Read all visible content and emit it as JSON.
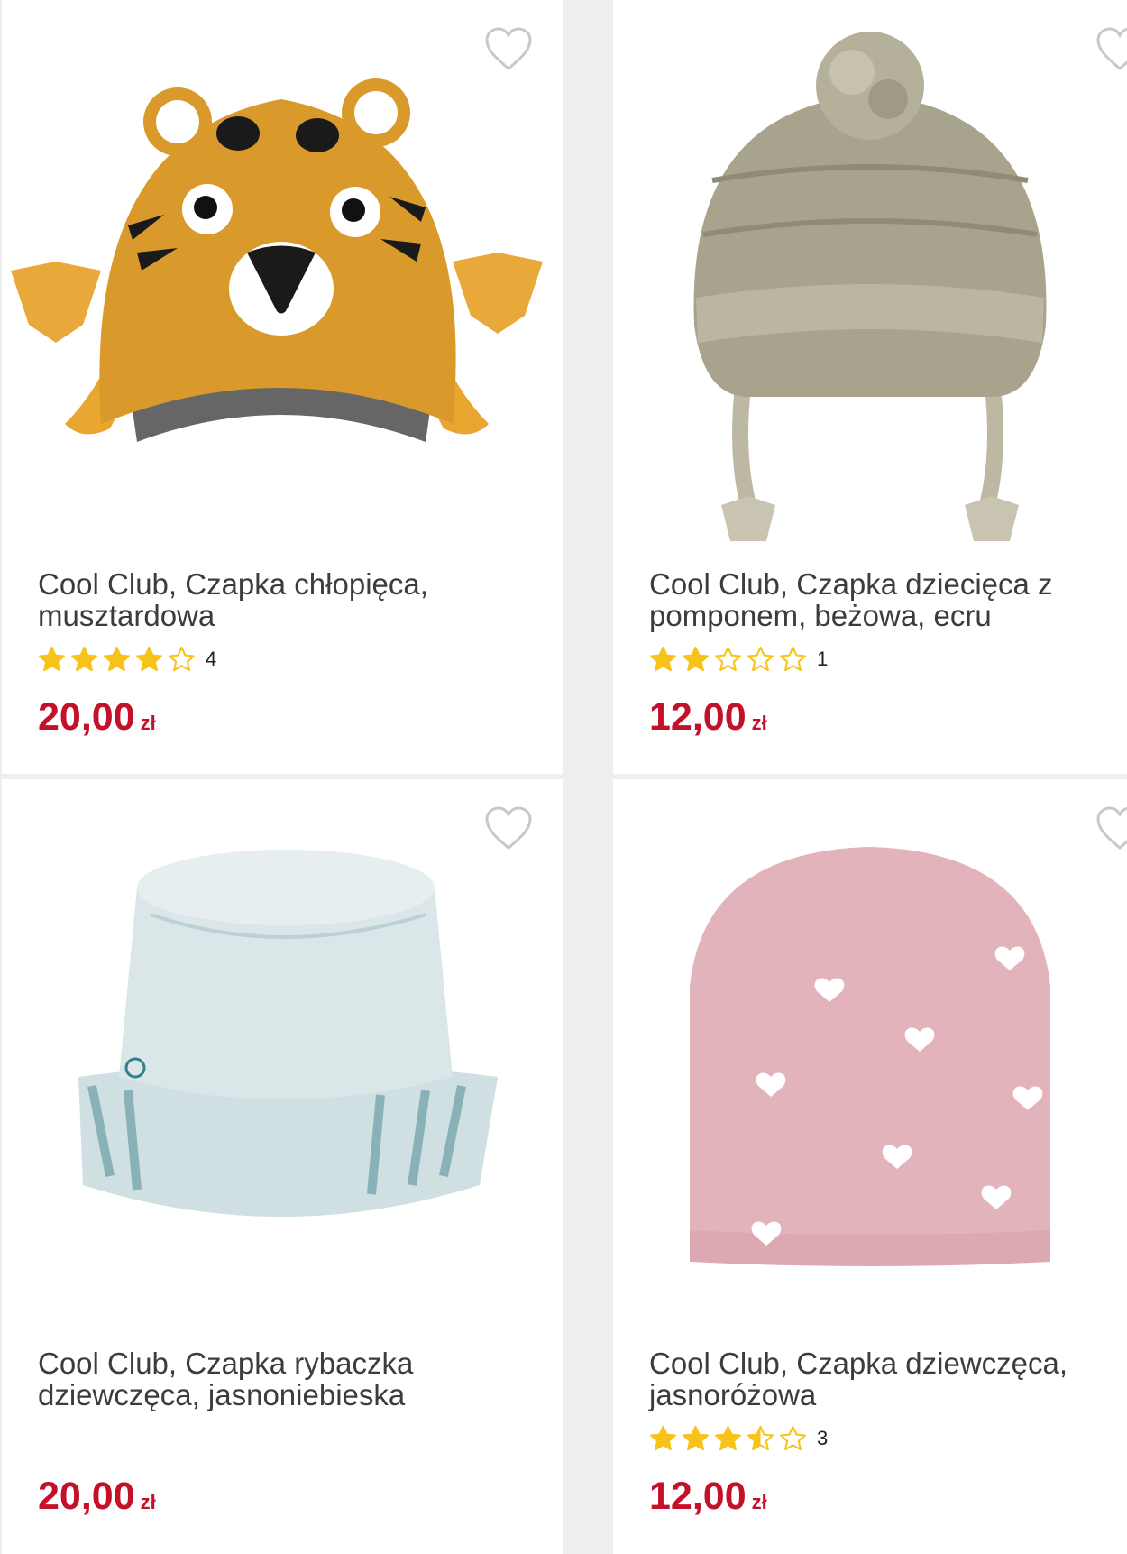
{
  "products": [
    {
      "title": "Cool Club, Czapka chłopięca, musztardowa",
      "rating": 4,
      "rating_count": "4",
      "price": "20,00",
      "currency": "zł",
      "image_icon": "tiger-knit-hat-image"
    },
    {
      "title": "Cool Club, Czapka dziecięca z pomponem, beżowa, ecru",
      "rating": 2,
      "rating_count": "1",
      "price": "12,00",
      "currency": "zł",
      "image_icon": "pompom-beanie-image"
    },
    {
      "title": "Cool Club, Czapka rybaczka dziewczęca, jasnoniebieska",
      "rating": null,
      "rating_count": null,
      "price": "20,00",
      "currency": "zł",
      "image_icon": "bucket-hat-image"
    },
    {
      "title": "Cool Club, Czapka dziewczęca, jasnoróżowa",
      "rating": 3.5,
      "rating_count": "3",
      "price": "12,00",
      "currency": "zł",
      "image_icon": "pink-heart-beanie-image"
    }
  ],
  "icons": {
    "favorite": "heart-outline-icon",
    "star": "star-icon"
  },
  "colors": {
    "price": "#c5102a",
    "star": "#f7c31b",
    "text": "#3c3c3c",
    "background": "#eeeeee"
  }
}
